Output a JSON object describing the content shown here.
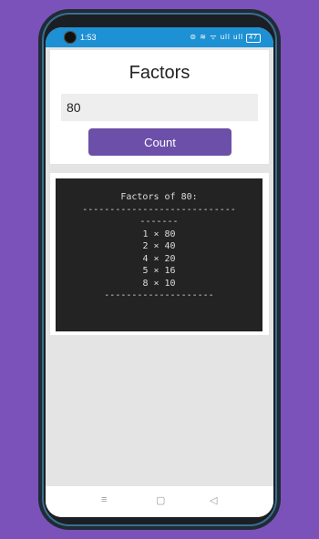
{
  "status_bar": {
    "time": "1:53",
    "icons": "⊜ ≋ ᯤ ull ull",
    "battery": "47"
  },
  "app": {
    "title": "Factors",
    "input_value": "80",
    "button_label": "Count"
  },
  "output": {
    "lines": [
      "Factors of 80:",
      "----------------------------",
      "-------",
      "1 × 80",
      "2 × 40",
      "4 × 20",
      "5 × 16",
      "8 × 10",
      "--------------------"
    ]
  },
  "navigation": {
    "menu_icon": "≡",
    "home_icon": "▢",
    "back_icon": "◁"
  }
}
